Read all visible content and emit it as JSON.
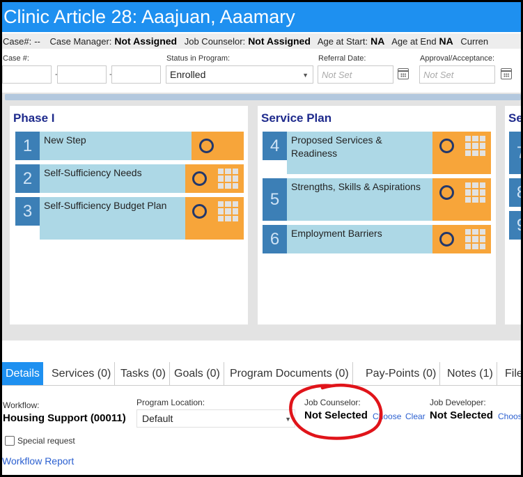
{
  "title": "Clinic Article 28: Aaajuan, Aaamary",
  "info_bar": {
    "case_label": "Case#:",
    "case_value": "--",
    "case_manager_label": "Case Manager:",
    "case_manager_value": "Not Assigned",
    "job_counselor_label": "Job Counselor:",
    "job_counselor_value": "Not Assigned",
    "age_start_label": "Age at Start:",
    "age_start_value": "NA",
    "age_end_label": "Age at End",
    "age_end_value": "NA",
    "current_label": "Curren"
  },
  "fields": {
    "case_no_label": "Case #:",
    "case_dash": "-",
    "status_label": "Status in Program:",
    "status_value": "Enrolled",
    "referral_label": "Referral Date:",
    "referral_placeholder": "Not Set",
    "approval_label": "Approval/Acceptance:",
    "approval_placeholder": "Not Set"
  },
  "phases": [
    {
      "title": "Phase I",
      "steps": [
        {
          "num": "1",
          "label": "New Step"
        },
        {
          "num": "2",
          "label": "Self-Sufficiency Needs"
        },
        {
          "num": "3",
          "label": "Self-Sufficiency Budget Plan"
        }
      ]
    },
    {
      "title": "Service Plan",
      "steps": [
        {
          "num": "4",
          "label": "Proposed Services & Readiness"
        },
        {
          "num": "5",
          "label": "Strengths, Skills & Aspirations"
        },
        {
          "num": "6",
          "label": "Employment Barriers"
        }
      ]
    },
    {
      "title": "Se",
      "steps": [
        {
          "num": "7"
        },
        {
          "num": "8"
        },
        {
          "num": "9"
        }
      ]
    }
  ],
  "tabs": [
    {
      "label": "Details"
    },
    {
      "label": "Services (0)"
    },
    {
      "label": "Tasks (0)"
    },
    {
      "label": "Goals (0)"
    },
    {
      "label": "Program Documents (0)"
    },
    {
      "label": "Pay-Points (0)"
    },
    {
      "label": "Notes (1)"
    },
    {
      "label": "File"
    }
  ],
  "details": {
    "workflow_label": "Workflow:",
    "workflow_value": "Housing Support (00011)",
    "location_label": "Program Location:",
    "location_value": "Default",
    "job_counselor_label": "Job Counselor:",
    "job_counselor_value": "Not Selected",
    "choose_link": "Choose",
    "clear_link": "Clear",
    "job_developer_label": "Job Developer:",
    "job_developer_value": "Not Selected",
    "job_developer_choose": "Choos",
    "special_request_label": "Special request",
    "workflow_report_link": "Workflow Report"
  },
  "colors": {
    "title_bar": "#1E90F0",
    "step_number": "#3C7FB6",
    "step_body": "#ADD8E6",
    "step_action": "#F7A53A",
    "phase_title": "#1E2A8C",
    "annotation": "#E0141A"
  }
}
